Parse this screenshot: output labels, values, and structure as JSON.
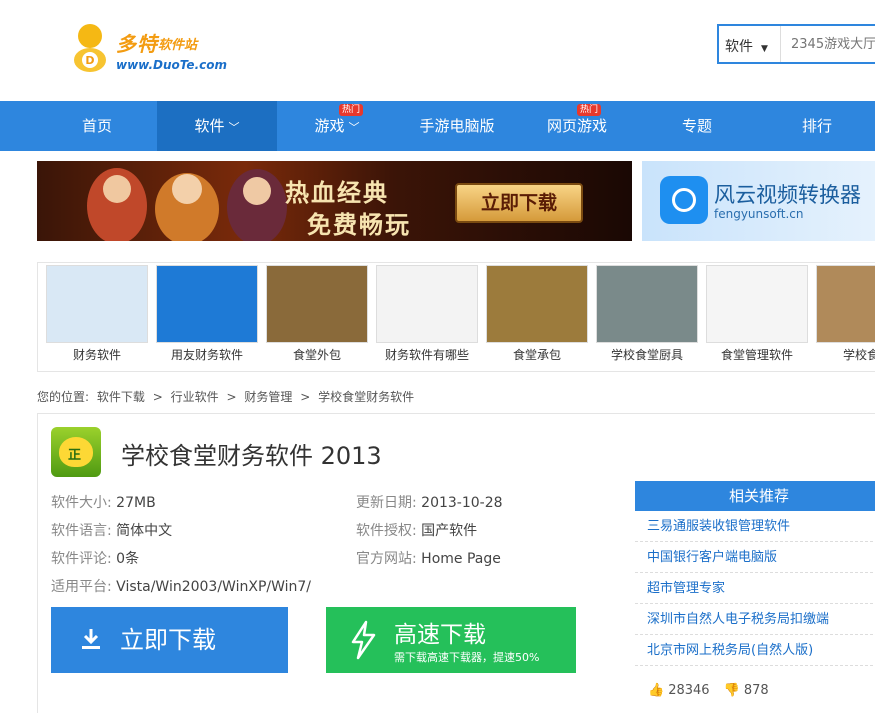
{
  "header": {
    "logo_name": "多特",
    "logo_sub": "软件站",
    "logo_url": "www.DuoTe.com",
    "search": {
      "category": "软件",
      "placeholder": "2345游戏大厅"
    }
  },
  "nav": {
    "items": [
      {
        "label": "首页"
      },
      {
        "label": "软件"
      },
      {
        "label": "游戏",
        "badge": "热门"
      },
      {
        "label": "手游电脑版"
      },
      {
        "label": "网页游戏",
        "badge": "热门"
      },
      {
        "label": "专题"
      },
      {
        "label": "排行"
      }
    ]
  },
  "banners": {
    "left": {
      "line1": "热血经典",
      "line2": "免费畅玩",
      "button": "立即下载"
    },
    "right": {
      "name": "风云视频转换器",
      "url": "fengyunsoft.cn"
    }
  },
  "thumbnails": [
    {
      "label": "财务软件",
      "color": "#d9e8f5"
    },
    {
      "label": "用友财务软件",
      "color": "#1e7ad6"
    },
    {
      "label": "食堂外包",
      "color": "#8a6a3a"
    },
    {
      "label": "财务软件有哪些",
      "color": "#f3f3f3"
    },
    {
      "label": "食堂承包",
      "color": "#9c7b3c"
    },
    {
      "label": "学校食堂厨具",
      "color": "#7a8a8a"
    },
    {
      "label": "食堂管理软件",
      "color": "#f5f5f5"
    },
    {
      "label": "学校食堂",
      "color": "#b08a5a"
    }
  ],
  "breadcrumb": [
    "您的位置:",
    "软件下载",
    ">",
    "行业软件",
    ">",
    "财务管理",
    ">",
    "学校食堂财务软件"
  ],
  "software": {
    "icon_char": "正",
    "title": "学校食堂财务软件 2013",
    "size_key": "软件大小:",
    "size": "27MB",
    "date_key": "更新日期:",
    "date": "2013-10-28",
    "lang_key": "软件语言:",
    "lang": "简体中文",
    "license_key": "软件授权:",
    "license": "国产软件",
    "comments_key": "软件评论:",
    "comments": "0条",
    "site_key": "官方网站:",
    "site": "Home Page",
    "platform_key": "适用平台:",
    "platform": "Vista/Win2003/WinXP/Win7/"
  },
  "buttons": {
    "download": "立即下载",
    "fast": "高速下载",
    "fast_sub": "需下载高速下载器，提速50%"
  },
  "related": {
    "title": "相关推荐",
    "items": [
      "三易通服装收银管理软件",
      "中国银行客户端电脑版",
      "超市管理专家",
      "深圳市自然人电子税务局扣缴端",
      "北京市网上税务局(自然人版)"
    ]
  },
  "votes": {
    "up": "28346",
    "down": "878"
  },
  "colors": {
    "primary": "#2e86de",
    "active": "#1c6fc2",
    "green": "#25c05a",
    "hot": "#e8382c"
  }
}
